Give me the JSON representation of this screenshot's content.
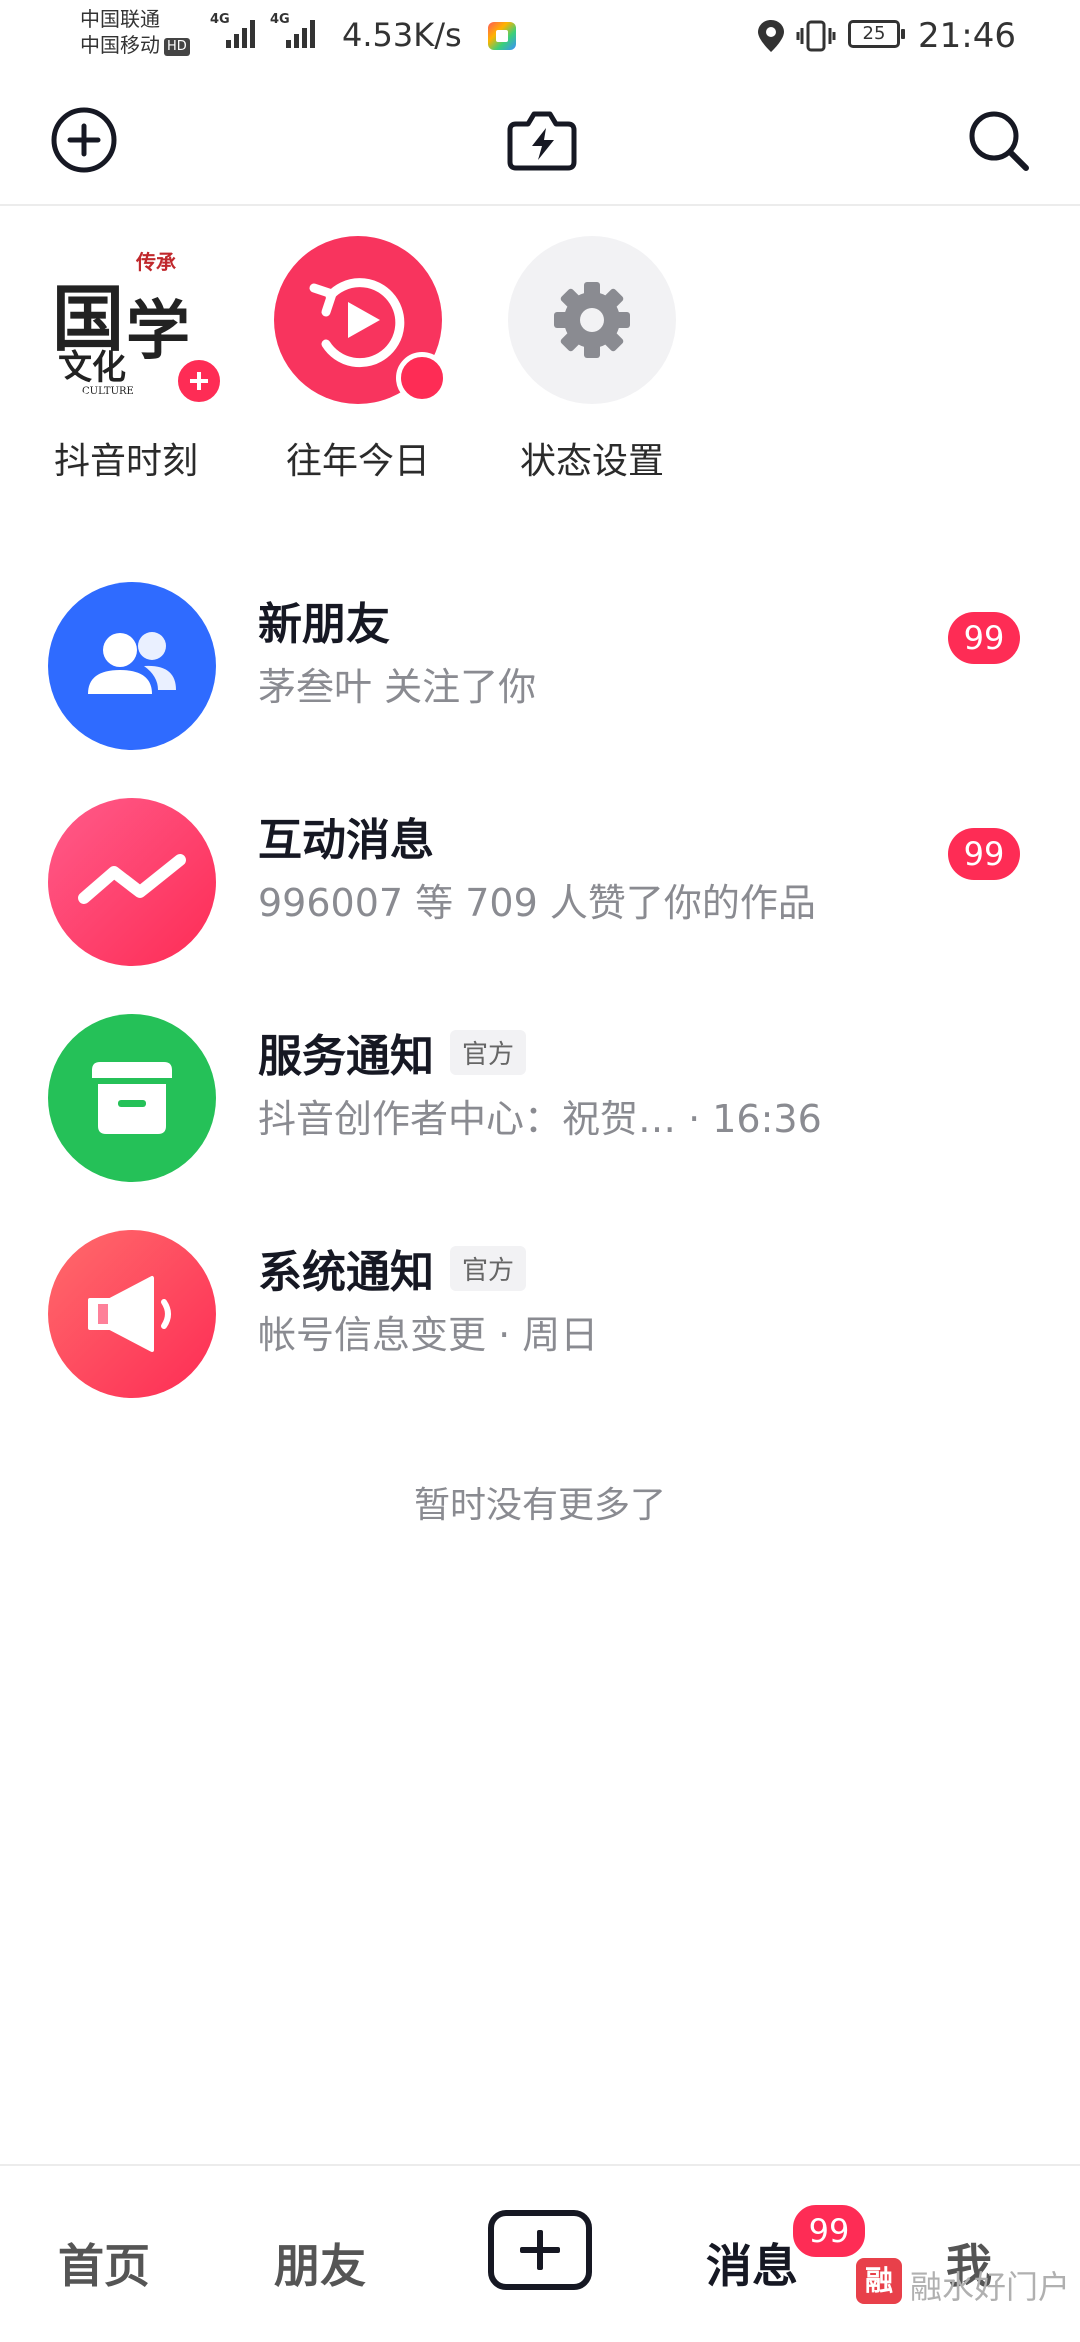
{
  "status_bar": {
    "carrier_1": "中国联通",
    "carrier_2": "中国移动",
    "hd": "HD",
    "sim1_network": "4G",
    "sim2_network": "4G",
    "net_speed": "4.53K/s",
    "battery": "25",
    "time": "21:46"
  },
  "header": {
    "left_icon": "add-circle-icon",
    "center_icon": "flash-camera-icon",
    "right_icon": "search-icon"
  },
  "stories": [
    {
      "label": "抖音时刻",
      "avatar_text_1": "国",
      "avatar_text_2": "学",
      "avatar_text_3": "文化",
      "avatar_seal": "传承",
      "avatar_caption": "CULTURE"
    },
    {
      "label": "往年今日"
    },
    {
      "label": "状态设置"
    }
  ],
  "messages": [
    {
      "title": "新朋友",
      "subtitle": "茅叁叶 关注了你",
      "badge": "99",
      "icon": "friends-icon",
      "color": "#2f6bff"
    },
    {
      "title": "互动消息",
      "subtitle": "996007 等 709 人赞了你的作品",
      "badge": "99",
      "icon": "zigzag-icon",
      "color": "#fe2c55"
    },
    {
      "title": "服务通知",
      "tag": "官方",
      "subtitle": "抖音创作者中心：祝贺… · 16:36",
      "icon": "inbox-icon",
      "color": "#25c158"
    },
    {
      "title": "系统通知",
      "tag": "官方",
      "subtitle": "帐号信息变更 · 周日",
      "icon": "megaphone-icon",
      "color": "#fe2c55"
    }
  ],
  "no_more": "暂时没有更多了",
  "bottom_nav": {
    "home": "首页",
    "friends": "朋友",
    "messages": "消息",
    "messages_badge": "99",
    "me": "我"
  },
  "watermark": {
    "logo": "融",
    "text": "融水好门户"
  }
}
